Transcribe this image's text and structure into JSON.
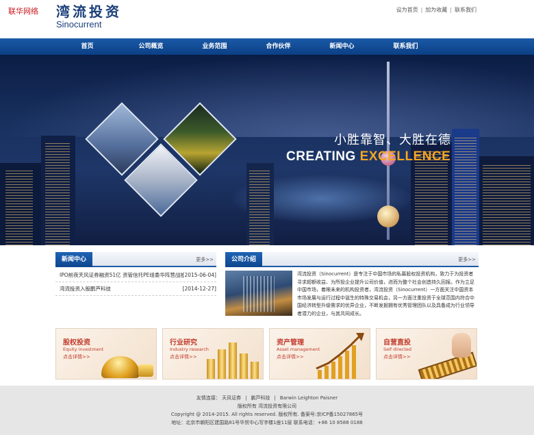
{
  "watermark": "联华网络",
  "header": {
    "logo_cn": "湾流投资",
    "logo_en": "Sinocurrent",
    "top_links": [
      "设为首页",
      "加为收藏",
      "联系我们"
    ]
  },
  "nav": [
    "首页",
    "公司概览",
    "业务范围",
    "合作伙伴",
    "新闻中心",
    "联系我们"
  ],
  "banner": {
    "slogan_cn": "小胜靠智、大胜在德",
    "slogan_en_1": "CREATING",
    "slogan_en_2": "EXCELLENCE"
  },
  "news": {
    "title": "新闻中心",
    "more": "更多>>",
    "items": [
      {
        "title": "IPO前夜天风证券融资51亿 资管信托PE组委华阵营战投",
        "date": "[2015-06-04]"
      },
      {
        "title": "湾流投资入股鹏芦科技",
        "date": "[2014-12-27]"
      }
    ]
  },
  "about": {
    "title": "公司介绍",
    "more": "更多>>",
    "text": "湾流投资（Sinocurrent）是专注于中国市场的私募股权投资机构，致力于为投资者寻求超额收益、为所投企业提升公司价值，进而为整个社会创造持久回报。作为立足中国市场，着眼未来的机构投资者，湾流投资（Sinocurrent）一方面关注中国资本市场发展与运行过程中诞生的特殊交易机会，另一方面注重投资于全球范围内符合中国经济转型升级需求的优异企业，不断发掘拥有优秀管理团队以及具备成为行业领导者潜力的企业，与其共同成长。"
  },
  "cards": [
    {
      "title": "股权投资",
      "en": "Equity investment",
      "more": "点击详情>>"
    },
    {
      "title": "行业研究",
      "en": "Industry research",
      "more": "点击详情>>"
    },
    {
      "title": "资产管理",
      "en": "Asset management",
      "more": "点击详情>>"
    },
    {
      "title": "自营直投",
      "en": "Self directed",
      "more": "点击详情>>"
    }
  ],
  "footer": {
    "links_label": "友情连接：",
    "links": [
      "天风证券",
      "鹏芦科技",
      "Barwin Leighton Paisner"
    ],
    "rights": "版权所有  湾流投资有限公司",
    "copyright": "Copyright @ 2014-2015. All rights reserved. 版权所有. 备案号:京ICP备15027865号",
    "address": "地址：北京市朝阳区建国路81号华贸中心写字楼1座11层  联系电话：+86 10 8588 0188"
  }
}
